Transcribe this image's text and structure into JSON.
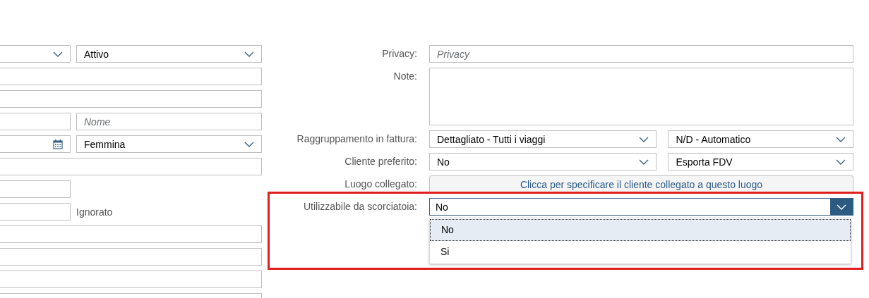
{
  "left_rows": [
    {
      "kind": "split",
      "fields": [
        {
          "kind": "select"
        },
        {
          "kind": "select",
          "value": "Attivo"
        }
      ]
    },
    {
      "kind": "full",
      "fields": [
        {
          "kind": "input"
        }
      ]
    },
    {
      "kind": "full",
      "fields": [
        {
          "kind": "input"
        }
      ]
    },
    {
      "kind": "split",
      "fields": [
        {
          "kind": "input"
        },
        {
          "kind": "input",
          "placeholder": "Nome"
        }
      ]
    },
    {
      "kind": "split",
      "fields": [
        {
          "kind": "date"
        },
        {
          "kind": "select",
          "value": "Femmina"
        }
      ]
    },
    {
      "kind": "full",
      "fields": [
        {
          "kind": "input"
        }
      ]
    },
    {
      "kind": "short",
      "fields": [
        {
          "kind": "input"
        }
      ]
    },
    {
      "kind": "short",
      "fields": [
        {
          "kind": "input"
        }
      ],
      "note": "Ignorato"
    },
    {
      "kind": "full",
      "fields": [
        {
          "kind": "input"
        }
      ]
    },
    {
      "kind": "full",
      "fields": [
        {
          "kind": "input"
        }
      ]
    },
    {
      "kind": "full",
      "fields": [
        {
          "kind": "input"
        }
      ]
    },
    {
      "kind": "full",
      "fields": [
        {
          "kind": "input"
        }
      ]
    }
  ],
  "right_rows": [
    {
      "label": "Privacy:",
      "kind": "input",
      "placeholder": "Privacy"
    },
    {
      "label": "Note:",
      "kind": "textarea"
    },
    {
      "label": "Raggruppamento in fattura:",
      "kind": "select_pair",
      "values": [
        "Dettagliato - Tutti i viaggi",
        "N/D - Automatico"
      ]
    },
    {
      "label": "Cliente preferito:",
      "kind": "select_pair",
      "values": [
        "No",
        "Esporta FDV"
      ]
    },
    {
      "label": "Luogo collegato:",
      "kind": "link_button",
      "text": "Clicca per specificare il cliente collegato a questo luogo"
    },
    {
      "label": "Utilizzabile da scorciatoia:",
      "kind": "select_open",
      "value": "No",
      "highlighted": true,
      "options": [
        {
          "label": "No",
          "selected": true
        },
        {
          "label": "Si",
          "selected": false
        }
      ]
    }
  ]
}
